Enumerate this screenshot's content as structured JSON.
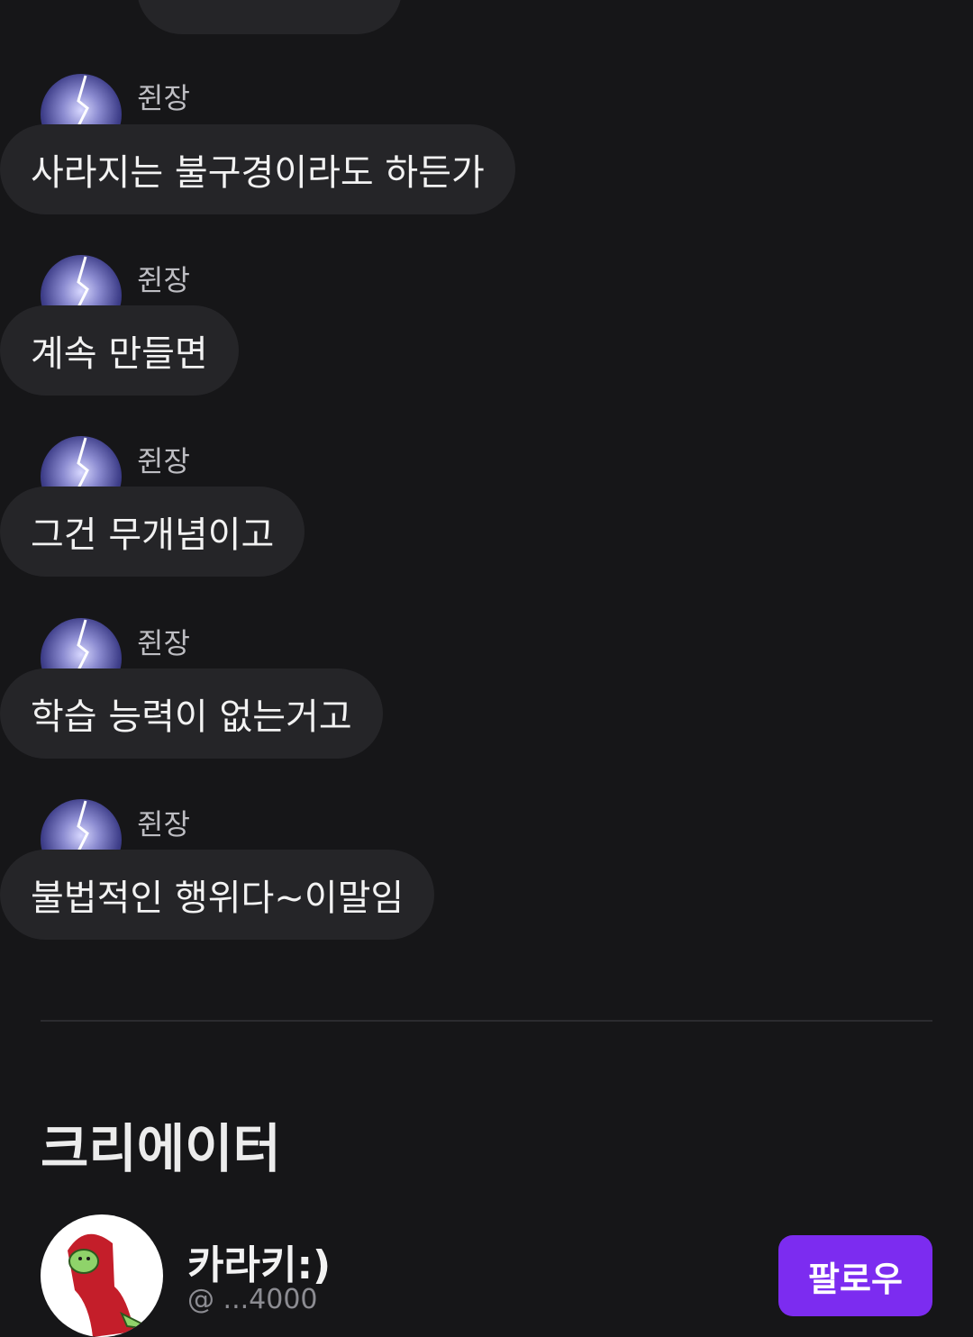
{
  "messages": [
    {
      "sender": "쥔장",
      "text": "사라지는 불구경이라도 하든가"
    },
    {
      "sender": "쥔장",
      "text": "계속 만들면"
    },
    {
      "sender": "쥔장",
      "text": "그건 무개념이고"
    },
    {
      "sender": "쥔장",
      "text": "학습 능력이 없는거고"
    },
    {
      "sender": "쥔장",
      "text": "불법적인 행위다~이말임"
    }
  ],
  "creators_section": {
    "title": "크리에이터",
    "creator": {
      "name": "카라키:)",
      "handle": "@ ...4000",
      "follow_label": "팔로우"
    }
  },
  "colors": {
    "background": "#161618",
    "bubble": "#252528",
    "accent": "#7c2cf0"
  }
}
